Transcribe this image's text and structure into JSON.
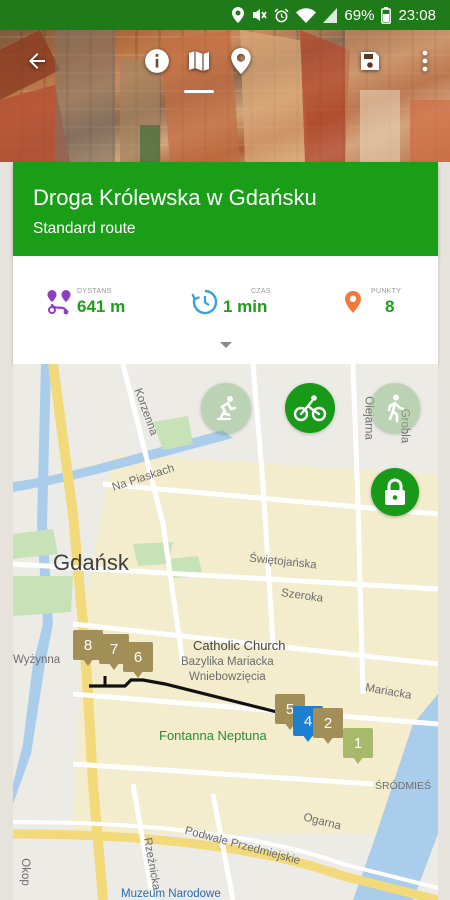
{
  "status_bar": {
    "battery": "69%",
    "time": "23:08",
    "icons": [
      "location-icon",
      "mute-icon",
      "alarm-icon",
      "wifi-icon",
      "signal-icon",
      "battery-icon"
    ]
  },
  "header": {
    "icons": [
      "back-arrow-icon",
      "info-icon",
      "map-icon",
      "location-pin-icon",
      "save-icon",
      "more-vert-icon"
    ],
    "active_tab": "map-icon"
  },
  "route": {
    "title": "Droga Królewska w Gdańsku",
    "subtitle": "Standard route"
  },
  "stats": {
    "distance": {
      "label": "DYSTANS",
      "value": "641 m",
      "icon": "route-icon",
      "color": "#8e3ec2"
    },
    "time": {
      "label": "CZAS",
      "value": "1 min",
      "icon": "clock-icon",
      "color": "#3aa0d8"
    },
    "points": {
      "label": "PUNKTY",
      "value": "8",
      "icon": "pin-icon",
      "color": "#f07a3c"
    }
  },
  "map": {
    "labels": {
      "korzenna": "Korzenna",
      "na_piaskach": "Na Piaskach",
      "gdansk": "Gdańsk",
      "swietojanska": "Świętojańska",
      "szeroka": "Szeroka",
      "catholic_church": "Catholic Church",
      "bazylika_1": "Bazylika Mariacka",
      "bazylika_2": "Wniebowzięcia",
      "mariacka": "Mariacka",
      "wyzynna": "Wyżynna",
      "fontanna": "Fontanna Neptuna",
      "srodmiescie": "ŚRÓDMIEŚ",
      "ogarna": "Ogarna",
      "podwale": "Podwale Przedmiejskie",
      "okopowa": "Okop",
      "rzeznicka": "Rzeźnicka",
      "olejarna": "Olejarna",
      "grobla": "Grobla",
      "teatr": "Muzeum Narodowe"
    },
    "transport_modes": [
      {
        "name": "skate",
        "state": "inactive"
      },
      {
        "name": "bike",
        "state": "active"
      },
      {
        "name": "walk",
        "state": "inactive"
      }
    ],
    "markers": [
      "8",
      "7",
      "6",
      "5",
      "4",
      "2",
      "1"
    ],
    "colors": {
      "route": "#111111",
      "marker": "#a28f57",
      "marker_active": "#1d7fd1",
      "marker_first": "#a9b96b",
      "accent": "#189a18"
    }
  }
}
